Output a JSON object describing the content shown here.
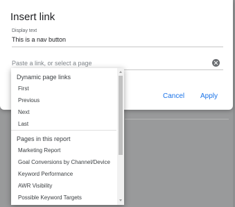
{
  "dialog": {
    "title": "Insert link",
    "display_text_label": "Display text",
    "display_text_value": "This is a nav button",
    "link_placeholder": "Paste a link, or select a page",
    "cancel_label": "Cancel",
    "apply_label": "Apply"
  },
  "dropdown": {
    "dynamic_header": "Dynamic page links",
    "dynamic_items": [
      "First",
      "Previous",
      "Next",
      "Last"
    ],
    "pages_header": "Pages in this report",
    "pages_items": [
      "Marketing Report",
      "Goal Conversions by Channel/Device",
      "Keyword Performance",
      "AWR Visibility",
      "Possible Keyword Targets"
    ]
  },
  "colors": {
    "accent": "#1a73e8",
    "top_accent": "#3367d6",
    "overlay": "#999a9b"
  }
}
